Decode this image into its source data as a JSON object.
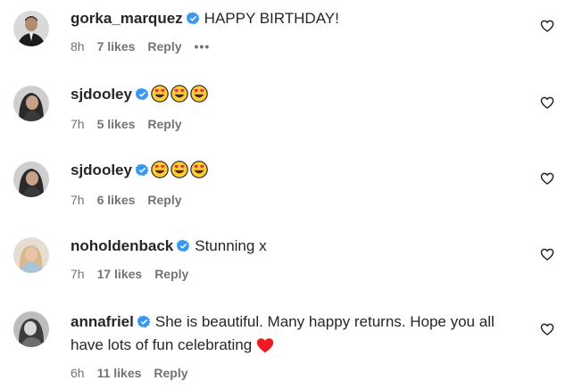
{
  "comments": [
    {
      "username": "gorka_marquez",
      "text": "HAPPY BIRTHDAY!",
      "time": "8h",
      "likes": "7 likes",
      "reply": "Reply",
      "more": "•••",
      "avatar": "avatar-man-suit"
    },
    {
      "username": "sjdooley",
      "text": "😍😍😍",
      "time": "7h",
      "likes": "5 likes",
      "reply": "Reply",
      "avatar": "avatar-woman-dark-hair"
    },
    {
      "username": "sjdooley",
      "text": "😍😍😍",
      "time": "7h",
      "likes": "6 likes",
      "reply": "Reply",
      "avatar": "avatar-woman-dark-hair"
    },
    {
      "username": "noholdenback",
      "text": "Stunning x",
      "time": "7h",
      "likes": "17 likes",
      "reply": "Reply",
      "avatar": "avatar-woman-blonde"
    },
    {
      "username": "annafriel",
      "text": "She is beautiful. Many happy returns. Hope you all have lots of fun celebrating",
      "emoji": "❤️",
      "time": "6h",
      "likes": "11 likes",
      "reply": "Reply",
      "avatar": "avatar-woman-bw"
    }
  ],
  "colors": {
    "text": "#262626",
    "meta": "#737373",
    "verified": "#3897f0",
    "heart_red": "#ed1c24"
  },
  "icons": {
    "verified": "verified-badge-icon",
    "like": "heart-outline-icon",
    "emoji": "heart-eyes-emoji-icon"
  }
}
